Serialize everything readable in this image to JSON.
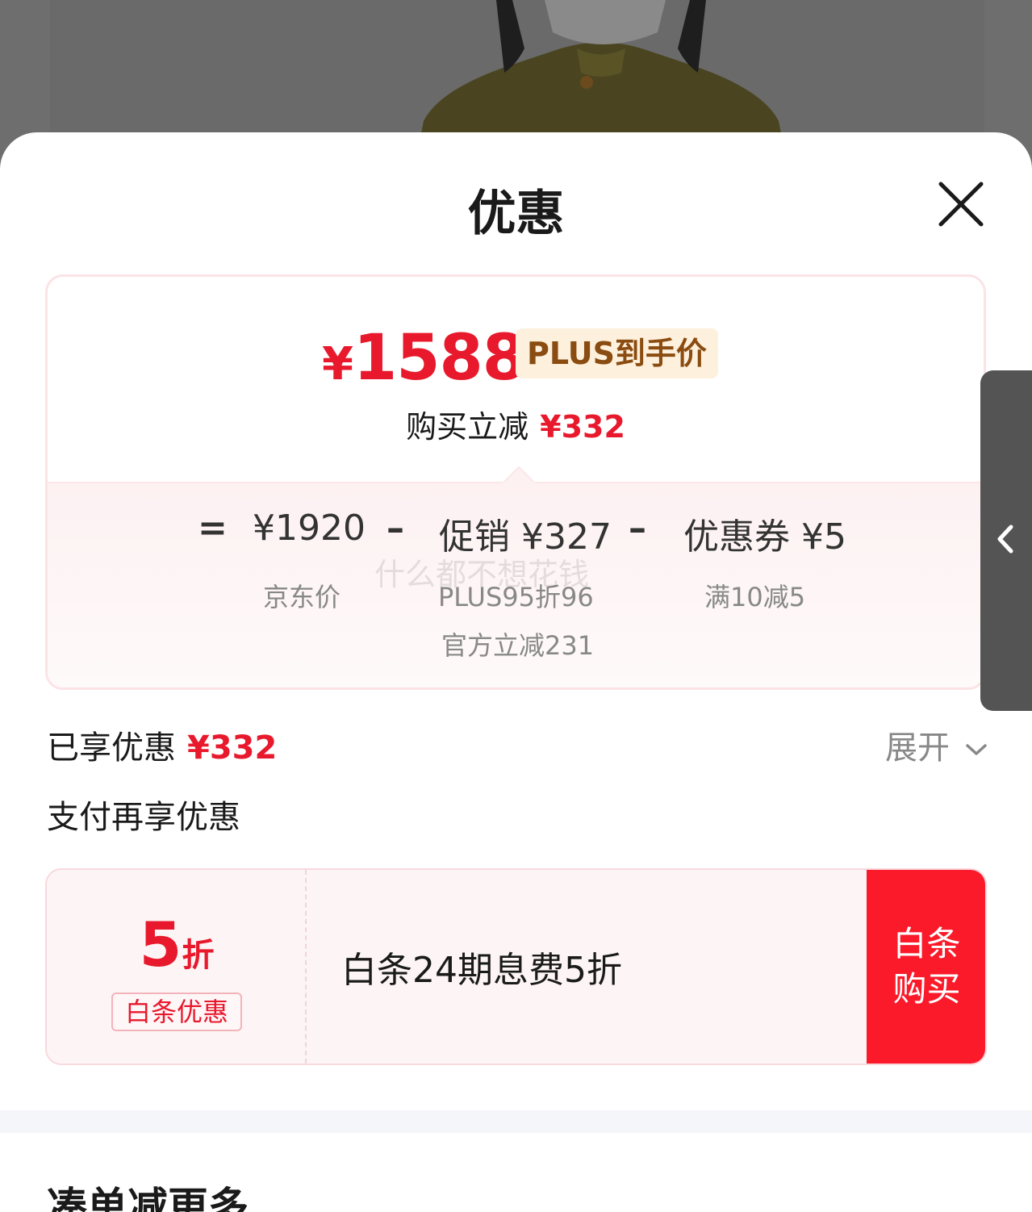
{
  "sheet": {
    "title": "优惠"
  },
  "price": {
    "yen": "¥",
    "final": "1588",
    "badge": "PLUS到手价",
    "discount_label": "购买立减",
    "discount_value": "¥332"
  },
  "breakdown": {
    "equals": "=",
    "minus": "–",
    "jd_price": "¥1920",
    "jd_price_label": "京东价",
    "promo": "促销 ¥327",
    "promo_detail_1": "PLUS95折96",
    "promo_detail_2": "官方立减231",
    "coupon": "优惠券 ¥5",
    "coupon_detail": "满10减5",
    "watermark": "什么都不想花钱"
  },
  "enjoyed": {
    "label": "已享优惠",
    "value": "¥332",
    "expand_label": "展开"
  },
  "payment": {
    "section_label": "支付再享优惠",
    "coupon_value": "5",
    "coupon_unit": "折",
    "coupon_tag": "白条优惠",
    "coupon_desc": "白条24期息费5折",
    "button_label": "白条购买"
  },
  "more": {
    "title": "凑单减更多"
  },
  "colors": {
    "accent_red": "#e8192c",
    "button_red": "#fb1a2a",
    "badge_bg": "#fdf0dd",
    "badge_text": "#8a4c10"
  }
}
